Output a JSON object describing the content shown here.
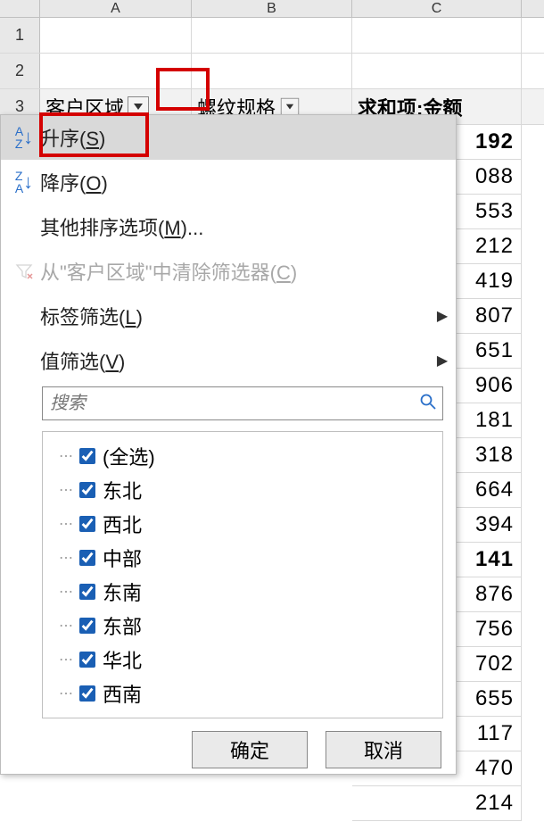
{
  "columns": {
    "A": "A",
    "B": "B",
    "C": "C"
  },
  "row_numbers": [
    "1",
    "2",
    "3"
  ],
  "header_row": {
    "field1": "客户区域",
    "field2": "螺纹规格",
    "field3": "求和项:金额"
  },
  "menu": {
    "sort_asc": {
      "label": "升序(",
      "hotkey": "S",
      "suffix": ")"
    },
    "sort_desc": {
      "label": "降序(",
      "hotkey": "O",
      "suffix": ")"
    },
    "more_sort": {
      "label": "其他排序选项(",
      "hotkey": "M",
      "suffix": ")..."
    },
    "clear_filter": {
      "prefix": "从\"客户区域\"中清除筛选器(",
      "hotkey": "C",
      "suffix": ")"
    },
    "label_filter": {
      "label": "标签筛选(",
      "hotkey": "L",
      "suffix": ")"
    },
    "value_filter": {
      "label": "值筛选(",
      "hotkey": "V",
      "suffix": ")"
    }
  },
  "search": {
    "placeholder": "搜索"
  },
  "tree": {
    "select_all": "(全选)",
    "items": [
      "东北",
      "西北",
      "中部",
      "东南",
      "东部",
      "华北",
      "西南"
    ]
  },
  "buttons": {
    "ok": "确定",
    "cancel": "取消"
  },
  "values": [
    {
      "v": "192",
      "bold": true
    },
    {
      "v": "088"
    },
    {
      "v": "553"
    },
    {
      "v": "212"
    },
    {
      "v": "419"
    },
    {
      "v": "807"
    },
    {
      "v": "651"
    },
    {
      "v": "906"
    },
    {
      "v": "181"
    },
    {
      "v": "318"
    },
    {
      "v": "664"
    },
    {
      "v": "394"
    },
    {
      "v": "141",
      "bold": true
    },
    {
      "v": "876"
    },
    {
      "v": "756"
    },
    {
      "v": "702"
    },
    {
      "v": "655"
    },
    {
      "v": "117"
    },
    {
      "v": "470"
    },
    {
      "v": "214"
    }
  ],
  "chart_data": null
}
